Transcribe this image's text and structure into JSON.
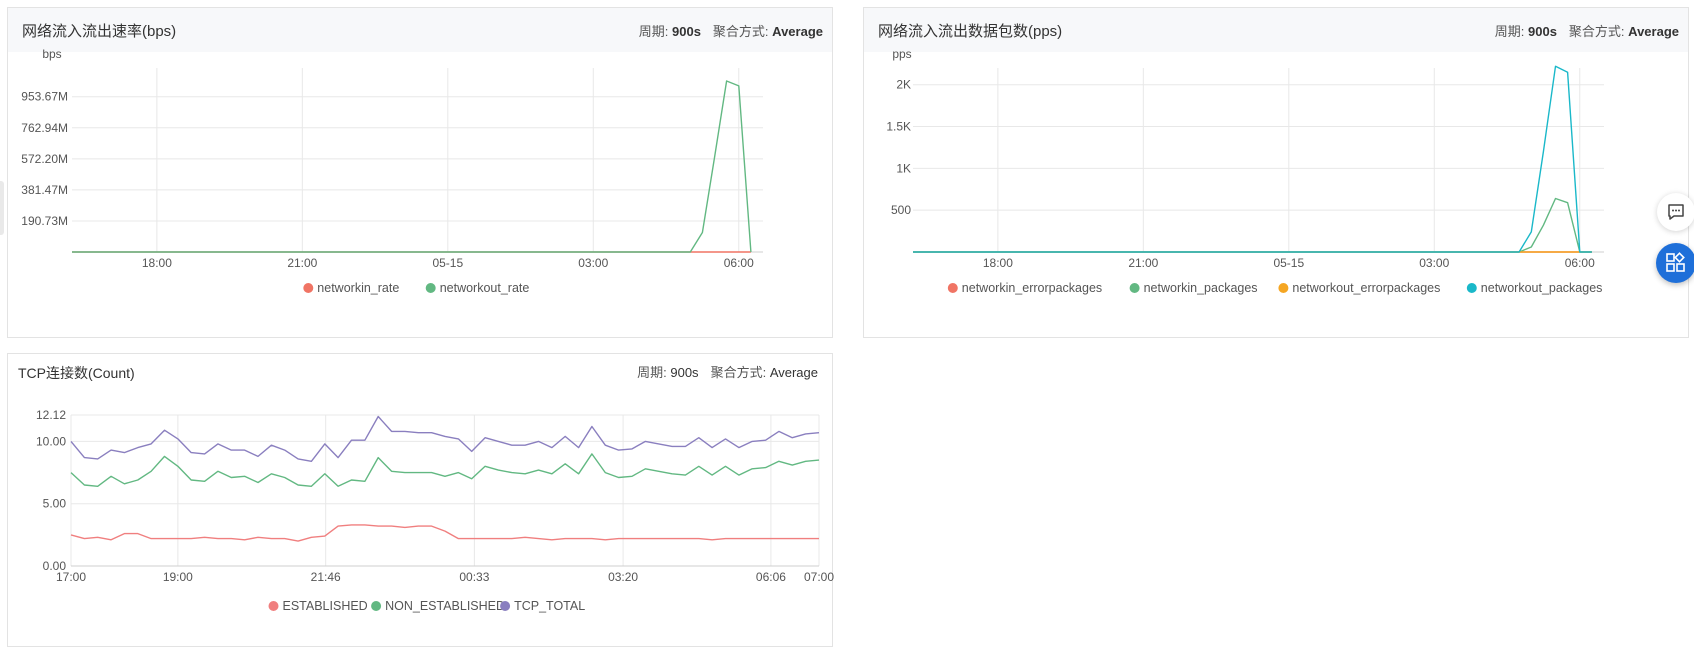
{
  "panels": [
    {
      "title": "网络流入流出速率(bps)",
      "meta_period_label": "周期:",
      "meta_period_value": "900s",
      "meta_agg_label": "聚合方式:",
      "meta_agg_value": "Average"
    },
    {
      "title": "网络流入流出数据包数(pps)",
      "meta_period_label": "周期:",
      "meta_period_value": "900s",
      "meta_agg_label": "聚合方式:",
      "meta_agg_value": "Average"
    },
    {
      "title": "TCP连接数(Count)",
      "meta_period_label": "周期:",
      "meta_period_value": "900s",
      "meta_agg_label": "聚合方式:",
      "meta_agg_value": "Average"
    }
  ],
  "icons": {
    "chat": "chat-bubble-icon",
    "apps": "apps-grid-icon"
  },
  "colors": {
    "accent": "#1e6fd9",
    "grid": "#e8e8e8",
    "axis": "#cfcfcf"
  },
  "chart_data": [
    {
      "type": "line",
      "unit_label": "bps",
      "x_start_hours": 16.25,
      "x_step_hours": 0.25,
      "ylim": [
        0,
        1130
      ],
      "y_ticks": [
        190.73,
        381.47,
        572.2,
        762.94,
        953.67
      ],
      "y_tick_labels": [
        "190.73M",
        "381.47M",
        "572.20M",
        "762.94M",
        "953.67M"
      ],
      "x_tick_hours": [
        18,
        21,
        24,
        27,
        30
      ],
      "x_tick_labels": [
        "18:00",
        "21:00",
        "05-15",
        "03:00",
        "06:00"
      ],
      "grid": true,
      "legend_position": "bottom",
      "series": [
        {
          "name": "networkin_rate",
          "color": "#f07464",
          "values": [
            0,
            0,
            0,
            0,
            0,
            0,
            0,
            0,
            0,
            0,
            0,
            0,
            0,
            0,
            0,
            0,
            0,
            0,
            0,
            0,
            0,
            0,
            0,
            0,
            0,
            0,
            0,
            0,
            0,
            0,
            0,
            0,
            0,
            0,
            0,
            0,
            0,
            0,
            0,
            0,
            0,
            0,
            0,
            0,
            0,
            0,
            0,
            0,
            0,
            0,
            0,
            0,
            0,
            0,
            0,
            0,
            0
          ]
        },
        {
          "name": "networkout_rate",
          "color": "#62b882",
          "values": [
            0,
            0,
            0,
            0,
            0,
            0,
            0,
            0,
            0,
            0,
            0,
            0,
            0,
            0,
            0,
            0,
            0,
            0,
            0,
            0,
            0,
            0,
            0,
            0,
            0,
            0,
            0,
            0,
            0,
            0,
            0,
            0,
            0,
            0,
            0,
            0,
            0,
            0,
            0,
            0,
            0,
            0,
            0,
            0,
            0,
            0,
            0,
            0,
            0,
            0,
            0,
            0,
            120,
            580,
            1050,
            1020,
            0
          ]
        }
      ]
    },
    {
      "type": "line",
      "unit_label": "pps",
      "x_start_hours": 16.25,
      "x_step_hours": 0.25,
      "ylim": [
        0,
        2200
      ],
      "y_ticks": [
        500,
        1000,
        1500,
        2000
      ],
      "y_tick_labels": [
        "500",
        "1K",
        "1.5K",
        "2K"
      ],
      "x_tick_hours": [
        18,
        21,
        24,
        27,
        30
      ],
      "x_tick_labels": [
        "18:00",
        "21:00",
        "05-15",
        "03:00",
        "06:00"
      ],
      "grid": true,
      "legend_position": "bottom",
      "series": [
        {
          "name": "networkin_errorpackages",
          "color": "#f07464",
          "values": [
            0,
            0,
            0,
            0,
            0,
            0,
            0,
            0,
            0,
            0,
            0,
            0,
            0,
            0,
            0,
            0,
            0,
            0,
            0,
            0,
            0,
            0,
            0,
            0,
            0,
            0,
            0,
            0,
            0,
            0,
            0,
            0,
            0,
            0,
            0,
            0,
            0,
            0,
            0,
            0,
            0,
            0,
            0,
            0,
            0,
            0,
            0,
            0,
            0,
            0,
            0,
            0,
            0,
            0,
            0,
            0,
            0
          ]
        },
        {
          "name": "networkin_packages",
          "color": "#62b882",
          "values": [
            0,
            0,
            0,
            0,
            0,
            0,
            0,
            0,
            0,
            0,
            0,
            0,
            0,
            0,
            0,
            0,
            0,
            0,
            0,
            0,
            0,
            0,
            0,
            0,
            0,
            0,
            0,
            0,
            0,
            0,
            0,
            0,
            0,
            0,
            0,
            0,
            0,
            0,
            0,
            0,
            0,
            0,
            0,
            0,
            0,
            0,
            0,
            0,
            0,
            0,
            0,
            60,
            320,
            640,
            590,
            0,
            0
          ]
        },
        {
          "name": "networkout_errorpackages",
          "color": "#f5a623",
          "values": [
            0,
            0,
            0,
            0,
            0,
            0,
            0,
            0,
            0,
            0,
            0,
            0,
            0,
            0,
            0,
            0,
            0,
            0,
            0,
            0,
            0,
            0,
            0,
            0,
            0,
            0,
            0,
            0,
            0,
            0,
            0,
            0,
            0,
            0,
            0,
            0,
            0,
            0,
            0,
            0,
            0,
            0,
            0,
            0,
            0,
            0,
            0,
            0,
            0,
            0,
            0,
            0,
            0,
            0,
            0,
            0,
            0
          ]
        },
        {
          "name": "networkout_packages",
          "color": "#1ab8c9",
          "values": [
            0,
            0,
            0,
            0,
            0,
            0,
            0,
            0,
            0,
            0,
            0,
            0,
            0,
            0,
            0,
            0,
            0,
            0,
            0,
            0,
            0,
            0,
            0,
            0,
            0,
            0,
            0,
            0,
            0,
            0,
            0,
            0,
            0,
            0,
            0,
            0,
            0,
            0,
            0,
            0,
            0,
            0,
            0,
            0,
            0,
            0,
            0,
            0,
            0,
            0,
            0,
            240,
            1200,
            2220,
            2150,
            0,
            0
          ]
        }
      ]
    },
    {
      "type": "line",
      "x_start_hours": 17,
      "x_step_hours": 0.25,
      "ylim": [
        0,
        12.12
      ],
      "y_ticks": [
        0,
        5,
        10,
        12.12
      ],
      "y_tick_labels": [
        "0.00",
        "5.00",
        "10.00",
        "12.12"
      ],
      "x_tick_hours": [
        17,
        19,
        21.7667,
        24.55,
        27.3333,
        30.1,
        31
      ],
      "x_tick_labels": [
        "17:00",
        "19:00",
        "21:46",
        "00:33",
        "03:20",
        "06:06",
        "07:00"
      ],
      "grid": true,
      "legend_position": "bottom",
      "series": [
        {
          "name": "ESTABLISHED",
          "color": "#f07f7f",
          "values": [
            2.5,
            2.2,
            2.3,
            2.1,
            2.6,
            2.6,
            2.2,
            2.2,
            2.2,
            2.2,
            2.3,
            2.2,
            2.2,
            2.1,
            2.3,
            2.2,
            2.2,
            2.0,
            2.3,
            2.4,
            3.2,
            3.3,
            3.3,
            3.2,
            3.2,
            3.1,
            3.2,
            3.2,
            2.8,
            2.2,
            2.2,
            2.2,
            2.2,
            2.2,
            2.3,
            2.2,
            2.1,
            2.2,
            2.2,
            2.2,
            2.1,
            2.2,
            2.2,
            2.2,
            2.2,
            2.2,
            2.2,
            2.2,
            2.1,
            2.2,
            2.2,
            2.2,
            2.2,
            2.2,
            2.2,
            2.2,
            2.2
          ]
        },
        {
          "name": "NON_ESTABLISHED",
          "color": "#62b882",
          "values": [
            7.5,
            6.5,
            6.4,
            7.2,
            6.6,
            6.9,
            7.6,
            8.8,
            8.0,
            6.9,
            6.8,
            7.6,
            7.1,
            7.2,
            6.7,
            7.4,
            7.1,
            6.5,
            6.4,
            7.4,
            6.4,
            6.9,
            6.8,
            8.7,
            7.6,
            7.5,
            7.5,
            7.5,
            7.2,
            7.5,
            7.0,
            8.0,
            7.7,
            7.5,
            7.4,
            7.7,
            7.4,
            8.2,
            7.4,
            9.0,
            7.5,
            7.1,
            7.2,
            7.8,
            7.6,
            7.4,
            7.3,
            8.0,
            7.3,
            8.0,
            7.3,
            7.8,
            7.9,
            8.4,
            8.1,
            8.4,
            8.5
          ]
        },
        {
          "name": "TCP_TOTAL",
          "color": "#8a7fbf",
          "values": [
            10.0,
            8.7,
            8.6,
            9.3,
            9.1,
            9.5,
            9.8,
            10.9,
            10.2,
            9.1,
            9.0,
            9.8,
            9.3,
            9.3,
            8.8,
            9.7,
            9.3,
            8.6,
            8.4,
            9.8,
            8.7,
            10.1,
            10.1,
            12.0,
            10.8,
            10.8,
            10.7,
            10.7,
            10.4,
            10.2,
            9.2,
            10.3,
            10.0,
            9.7,
            9.7,
            10.0,
            9.5,
            10.4,
            9.5,
            11.2,
            9.7,
            9.3,
            9.4,
            10.0,
            9.8,
            9.6,
            9.6,
            10.3,
            9.5,
            10.2,
            9.5,
            10.0,
            10.1,
            10.8,
            10.3,
            10.6,
            10.7
          ]
        }
      ]
    }
  ]
}
